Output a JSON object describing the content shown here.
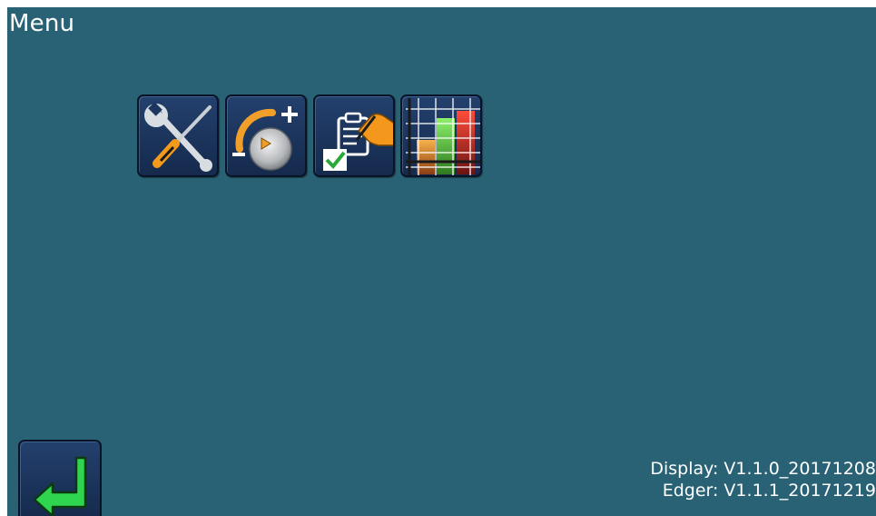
{
  "header": {
    "title": "Menu"
  },
  "menu": {
    "tiles": [
      {
        "icon": "wrench-screwdriver-icon"
      },
      {
        "icon": "adjust-dial-icon"
      },
      {
        "icon": "clipboard-checklist-icon"
      },
      {
        "icon": "bar-chart-icon"
      }
    ]
  },
  "footer": {
    "back_icon": "enter-return-arrow-icon",
    "display_version": "Display: V1.1.0_20171208",
    "edger_version": "Edger: V1.1.1_20171219"
  },
  "colors": {
    "background": "#296274",
    "tile": "#1d3760",
    "arrow": "#2fd54f",
    "orange": "#f0a02a",
    "red": "#e02a1e",
    "green": "#3fbf2a"
  }
}
